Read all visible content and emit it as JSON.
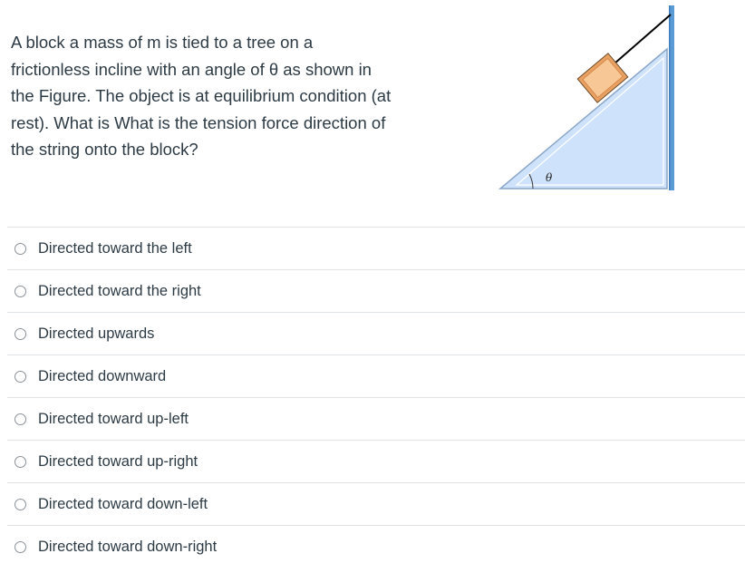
{
  "question": {
    "text": "A block a mass of m is tied to a tree on a frictionless incline with an angle of θ as shown in the Figure. The object is at equilibrium condition (at rest). What is What is the tension force direction of the string onto the block?"
  },
  "figure": {
    "angle_label": "θ",
    "colors": {
      "incline_fill": "#cfe2fb",
      "incline_edge": "#8aa6c8",
      "tree": "#5b9bd5",
      "block_outer": "#e8a162",
      "block_inner": "#f7c896",
      "string": "#000000"
    }
  },
  "answers": [
    {
      "label": "Directed toward the left",
      "selected": false
    },
    {
      "label": "Directed toward the right",
      "selected": false
    },
    {
      "label": "Directed upwards",
      "selected": false
    },
    {
      "label": "Directed downward",
      "selected": false
    },
    {
      "label": "Directed toward up-left",
      "selected": false
    },
    {
      "label": "Directed toward up-right",
      "selected": false
    },
    {
      "label": "Directed toward down-left",
      "selected": false
    },
    {
      "label": "Directed toward down-right",
      "selected": false
    }
  ]
}
